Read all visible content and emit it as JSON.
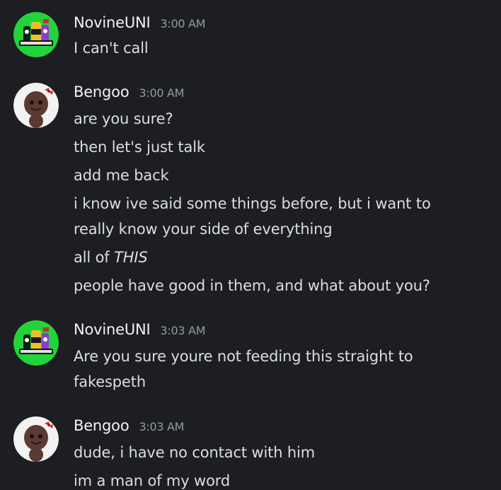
{
  "messages": [
    {
      "author": "NovineUNI",
      "time": "3:00 AM",
      "avatar_icon": "green-mascot-logo-avatar",
      "lines": [
        "I can't call"
      ]
    },
    {
      "author": "Bengoo",
      "time": "3:00 AM",
      "avatar_icon": "knitted-doll-avatar",
      "lines": [
        "are you sure?",
        "then let's just talk",
        "add me back",
        "i know ive said some things before, but i want to",
        "really know your side of everything",
        "all of ",
        "THIS",
        "people have good in them, and what about you?"
      ]
    },
    {
      "author": "NovineUNI",
      "time": "3:03 AM",
      "avatar_icon": "green-mascot-logo-avatar",
      "lines": [
        "Are you sure youre not feeding this straight to",
        "fakespeth"
      ]
    },
    {
      "author": "Bengoo",
      "time": "3:03 AM",
      "avatar_icon": "knitted-doll-avatar",
      "lines": [
        "dude, i have no contact with him",
        "im a man of my word"
      ]
    }
  ],
  "colors": {
    "background": "#1d1e22",
    "username": "#f2f3f5",
    "timestamp": "#949ba4",
    "text": "#dbdee1",
    "avatar_green": "#22d43a"
  }
}
